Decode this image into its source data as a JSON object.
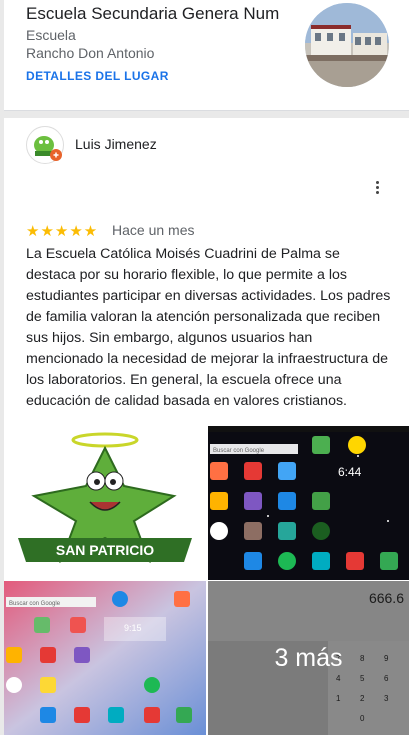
{
  "place": {
    "name": "Escuela Secundaria Genera Num",
    "type": "Escuela",
    "location": "Rancho Don Antonio",
    "details_label": "DETALLES DEL LUGAR"
  },
  "review": {
    "author": "Luis Jimenez",
    "stars": "★★★★★",
    "rating": 5,
    "time": "Hace un mes",
    "text": "La Escuela Católica Moisés Cuadrini de Palma se destaca por su horario flexible, lo que permite a los estudiantes participar en diversas actividades. Los padres de familia valoran la atención personalizada que reciben sus hijos. Sin embargo, algunos usuarios han mencionado la necesidad de mejorar la infraestructura de los laboratorios. En general, la escuela ofrece una educación de calidad basada en valores cristianos."
  },
  "photos": {
    "banner_text": "SAN PATRICIO",
    "tablet1_search": "Buscar con Google",
    "tablet1_clock": "6:44",
    "tablet2_search": "Buscar con Google",
    "tablet2_clock": "9:15",
    "calc_display": "666.6",
    "more_label": "3 más"
  },
  "colors": {
    "accent": "#1a73e8",
    "star": "#fbbc04"
  }
}
